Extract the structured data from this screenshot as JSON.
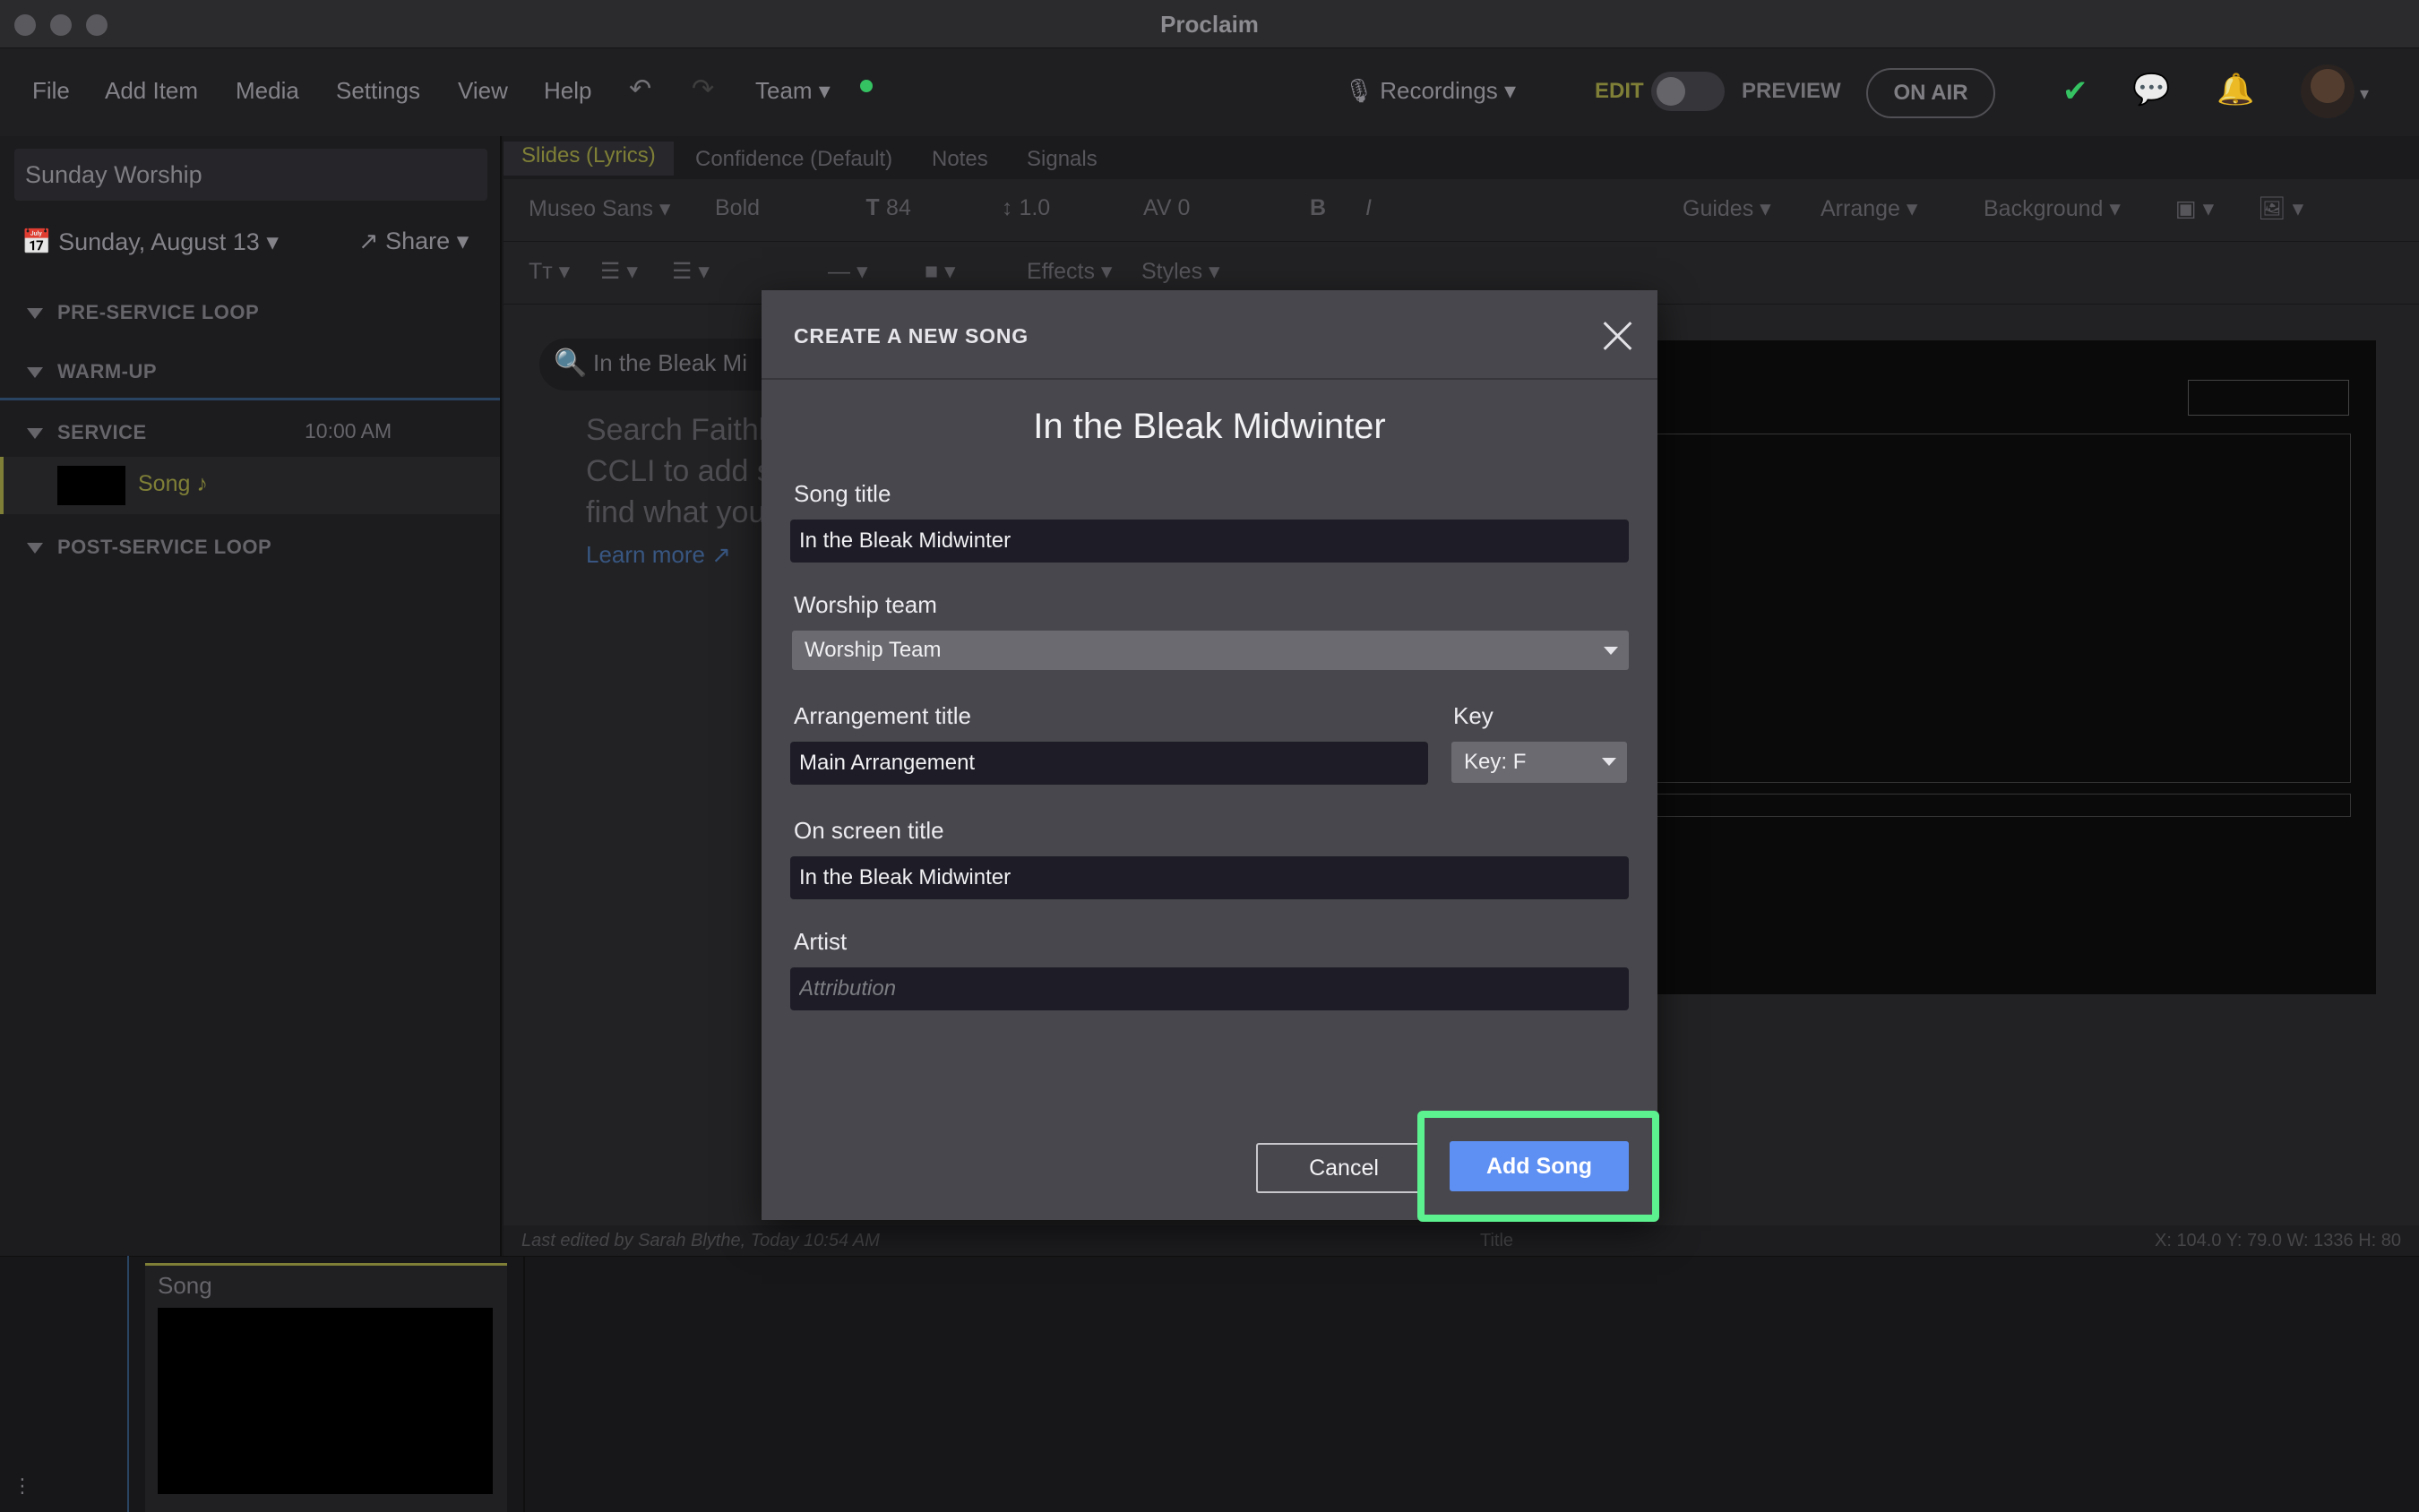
{
  "window": {
    "title": "Proclaim"
  },
  "menu": {
    "file": "File",
    "add_item": "Add Item",
    "media": "Media",
    "settings": "Settings",
    "view": "View",
    "help": "Help",
    "team": "Team",
    "recordings": "Recordings",
    "edit": "EDIT",
    "preview": "PREVIEW",
    "on_air": "ON AIR"
  },
  "sidebar": {
    "service_name": "Sunday Worship",
    "date": "Sunday, August 13",
    "share": "Share",
    "sections": {
      "pre_service": "PRE-SERVICE LOOP",
      "warm_up": "WARM-UP",
      "service": "SERVICE",
      "service_time": "10:00 AM",
      "post_service": "POST-SERVICE LOOP"
    },
    "song_item": "Song ♪"
  },
  "editor": {
    "tabs": [
      "Slides (Lyrics)",
      "Confidence (Default)",
      "Notes",
      "Signals"
    ],
    "font": "Museo Sans",
    "weight": "Bold",
    "font_size": "84",
    "line_height": "1.0",
    "spacing": "0",
    "guides": "Guides",
    "arrange": "Arrange",
    "background": "Background",
    "effects": "Effects",
    "styles": "Styles",
    "search_text": "In the Bleak Mi",
    "search_help": "Search Faithl CCLI to add s find what you",
    "learn_more": "Learn more",
    "status_left": "Last edited by Sarah Blythe, Today 10:54 AM",
    "status_mid": "Title",
    "status_right": "X: 104.0  Y: 79.0    W: 1336  H: 80"
  },
  "bottom": {
    "thumb_title": "Song"
  },
  "modal": {
    "header": "CREATE A NEW SONG",
    "heading": "In the Bleak Midwinter",
    "song_title_label": "Song title",
    "song_title_value": "In the Bleak Midwinter",
    "worship_team_label": "Worship team",
    "worship_team_value": "Worship Team",
    "arrangement_label": "Arrangement title",
    "arrangement_value": "Main Arrangement",
    "key_label": "Key",
    "key_value": "Key: F",
    "onscreen_label": "On screen title",
    "onscreen_value": "In the Bleak Midwinter",
    "artist_label": "Artist",
    "artist_placeholder": "Attribution",
    "cancel": "Cancel",
    "add_song": "Add Song"
  },
  "colors": {
    "accent_blue": "#5e8ff2",
    "highlight_green": "#5cf28f",
    "active_yellow": "#8a8a3c"
  }
}
